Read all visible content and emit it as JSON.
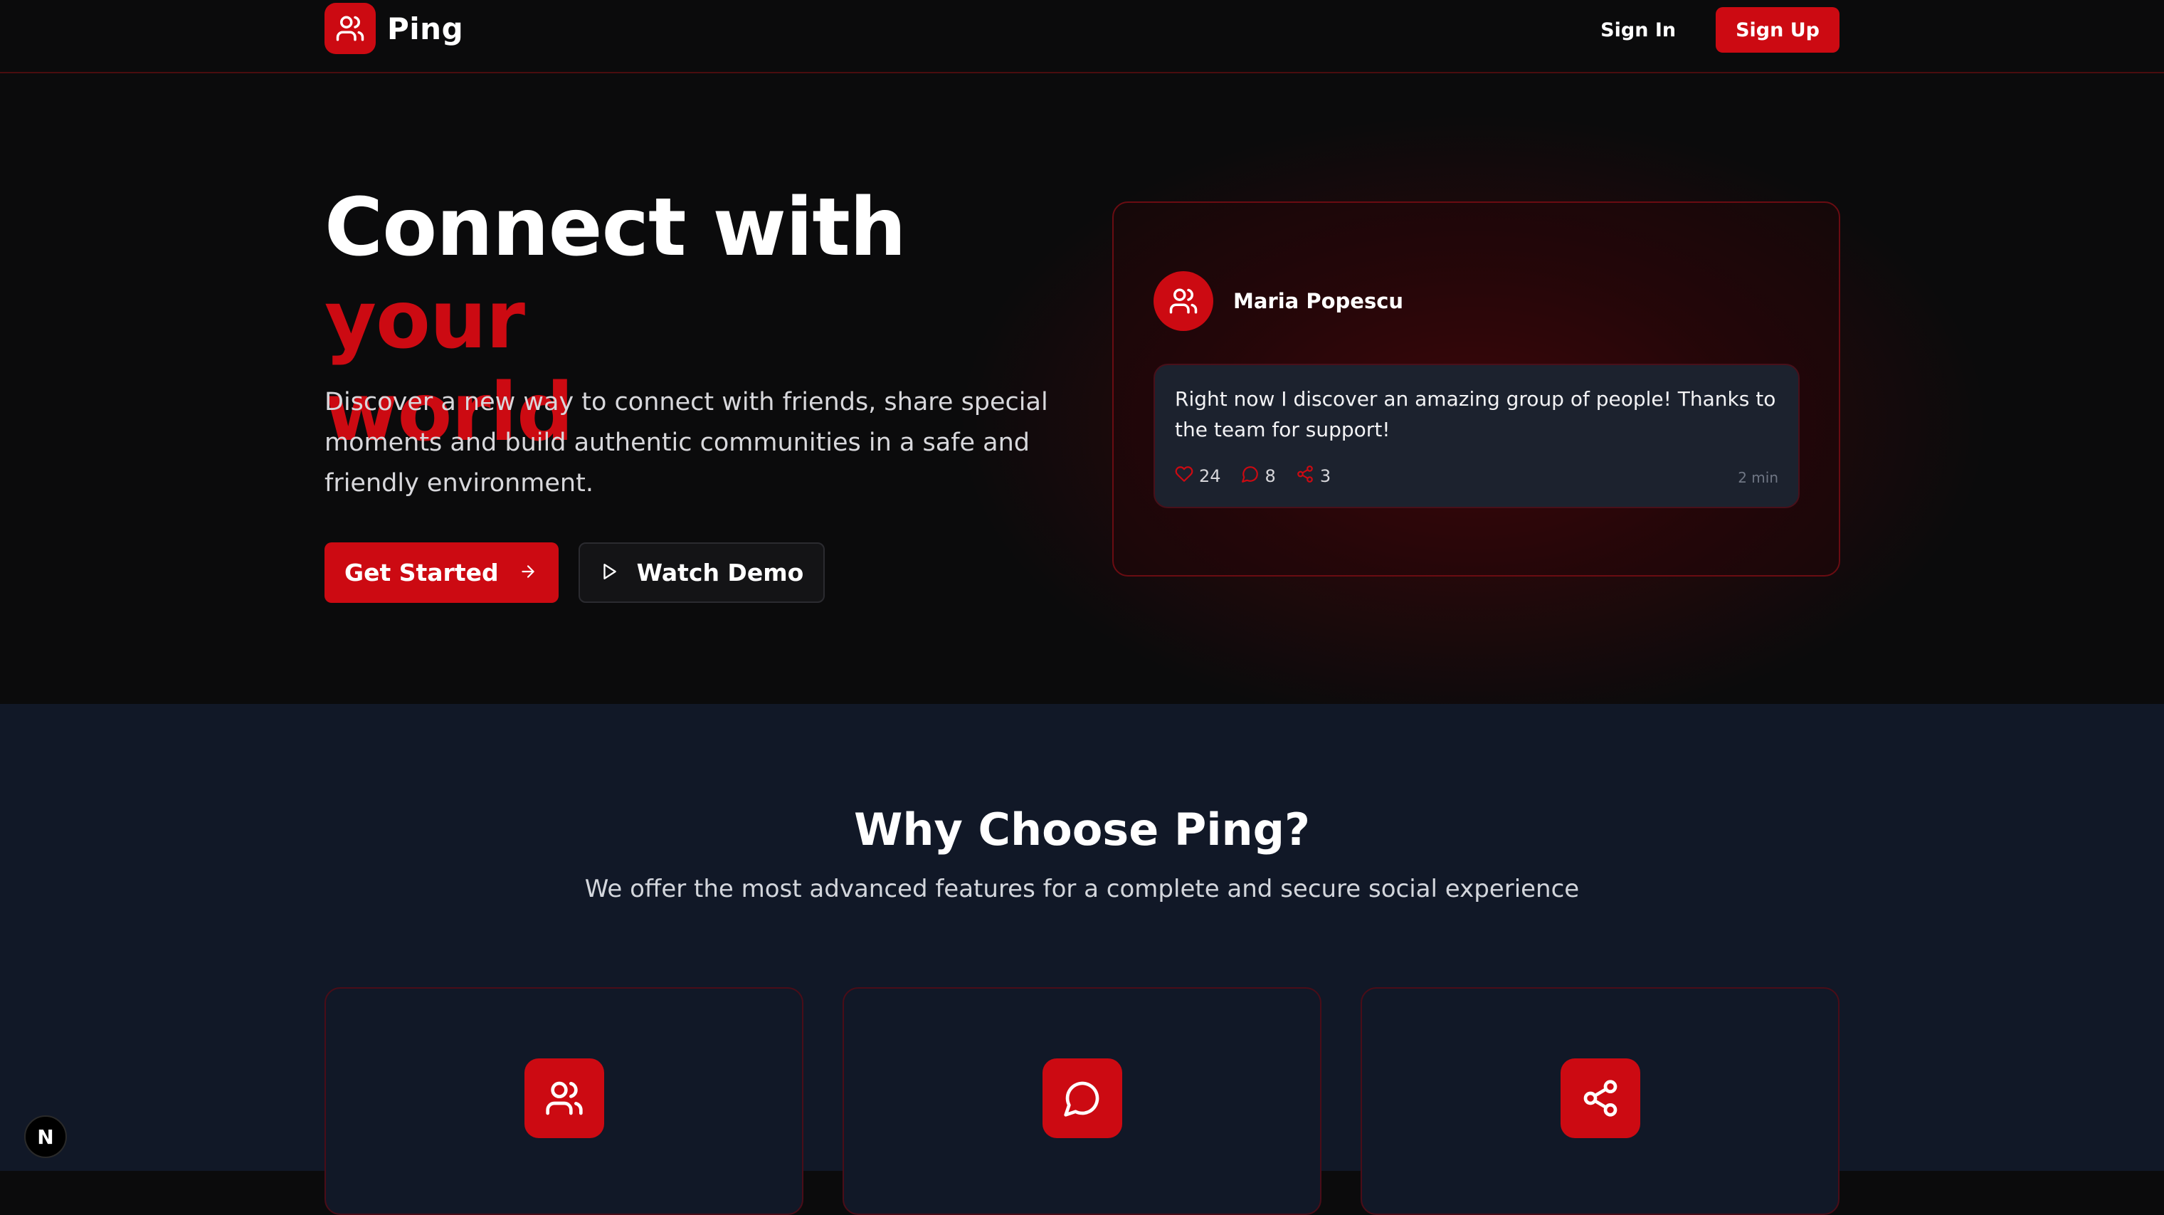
{
  "nav": {
    "brand": "Ping",
    "sign_in": "Sign In",
    "sign_up": "Sign Up"
  },
  "hero": {
    "headline_part1": "Connect with ",
    "headline_accent1": "your",
    "headline_accent2": "world",
    "subtext": "Discover a new way to connect with friends, share special moments and build authentic communities in a safe and friendly environment.",
    "primary_cta": "Get Started",
    "secondary_cta": "Watch Demo"
  },
  "preview": {
    "author": "Maria Popescu",
    "post_text": "Right now I discover an amazing group of people! Thanks to the team for support!",
    "likes": "24",
    "comments": "8",
    "shares": "3",
    "time": "2 min"
  },
  "features": {
    "title": "Why Choose Ping?",
    "subtitle": "We offer the most advanced features for a complete and secure social experience",
    "cards": [
      {
        "icon": "users-icon"
      },
      {
        "icon": "chat-bubble-icon"
      },
      {
        "icon": "share-icon"
      }
    ]
  },
  "badge": {
    "label": "N"
  },
  "colors": {
    "accent": "#cc0a12",
    "background": "#0b0b0c",
    "section_bg": "#111827"
  }
}
